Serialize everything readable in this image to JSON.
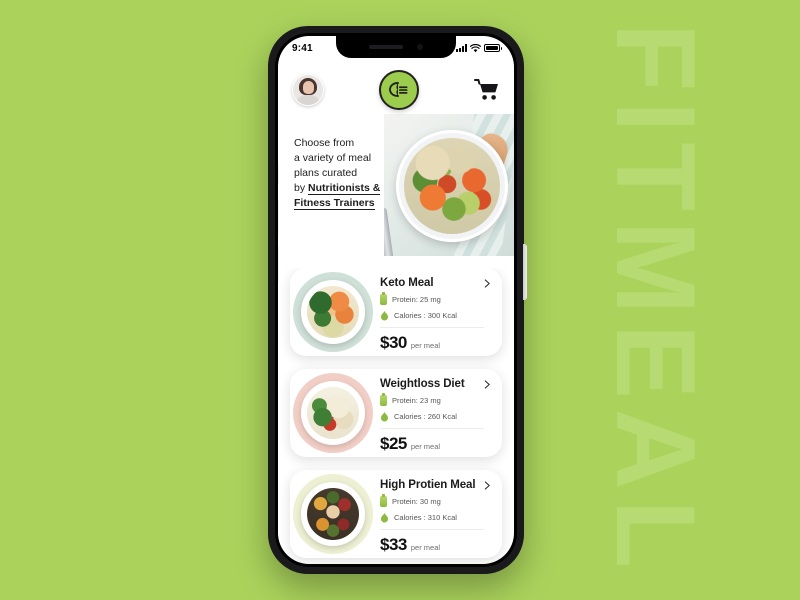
{
  "background": {
    "color": "#abd35c",
    "watermark_text": "FITMEAL",
    "watermark_color": "#b8da72"
  },
  "phone": {
    "status_bar": {
      "time": "9:41",
      "signal_icon": "cellular-signal-icon",
      "wifi_icon": "wifi-icon",
      "battery_icon": "battery-icon"
    },
    "header": {
      "avatar": "user-avatar",
      "logo": "fitmeal-logo",
      "cart": "shopping-cart-icon"
    },
    "hero": {
      "line1": "Choose from",
      "line2": "a variety of meal",
      "line3": "plans curated",
      "line4_prefix": "by ",
      "line4_highlight": "Nutritionists &",
      "line5_highlight": "Fitness Trainers",
      "image_alt": "meal-bowl-photo"
    },
    "meals": [
      {
        "title": "Keto Meal",
        "protein": "Protein: 25 mg",
        "calories": "Calories : 300 Kcal",
        "price": "$30",
        "price_unit": "per meal",
        "blob_color": "#cfe0d8",
        "food_class": "food-keto",
        "chevron": "chevron-right-icon"
      },
      {
        "title": "Weightloss Diet",
        "protein": "Protein: 23 mg",
        "calories": "Calories : 260 Kcal",
        "price": "$25",
        "price_unit": "per meal",
        "blob_color": "#f2cfc6",
        "food_class": "food-weightloss",
        "chevron": "chevron-right-icon"
      },
      {
        "title": "High Protien Meal",
        "protein": "Protein: 30 mg",
        "calories": "Calories : 310 Kcal",
        "price": "$33",
        "price_unit": "per meal",
        "blob_color": "#eef0d4",
        "food_class": "food-protein",
        "chevron": "chevron-right-icon"
      }
    ]
  }
}
